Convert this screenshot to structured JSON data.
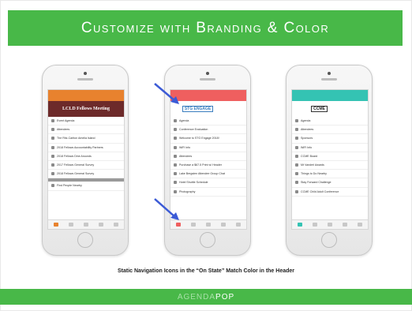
{
  "title": "Customize with Branding & Color",
  "caption": "Static Navigation Icons in the “On State” Match Color in the Header",
  "brand": {
    "part1": "AGENDA",
    "part2": "POP"
  },
  "phones": [
    {
      "accent": "#e8822e",
      "header_color": "#e8822e",
      "banner_bg": "#6d2a2a",
      "banner_text": "LCLD Fellows Meeting",
      "items": [
        "Event Agenda",
        "Attendees",
        "The Ritz-Carlton Amelia Island",
        "2018 Fellows Accountability Partners",
        "2018 Fellows Dine Arounds",
        "2017 Fellows General Survey",
        "2018 Fellows General Survey",
        "Find People Nearby"
      ]
    },
    {
      "accent": "#ef5f5f",
      "header_color": "#ef5f5f",
      "banner_text": "STG ENGAGE",
      "items": [
        "Agenda",
        "Conference Evaluation",
        "Welcome to STG Engage 2018!",
        "WiFi Info",
        "Attendees",
        "Purchase a $67.5 Print w/ Header",
        "Lake Bergsten Attendee Group Chat",
        "Hotel Shuttle Schedule",
        "Photography"
      ]
    },
    {
      "accent": "#34c3b3",
      "header_color": "#34c3b3",
      "banner_text": "CCME",
      "items": [
        "Agenda",
        "Attendees",
        "Sponsors",
        "WiFi Info",
        "CCME Board",
        "Mt Vanderl Awards",
        "Things to Do Nearby",
        "Stay Forward Challenge",
        "CCME Child Adult Conference"
      ]
    }
  ]
}
